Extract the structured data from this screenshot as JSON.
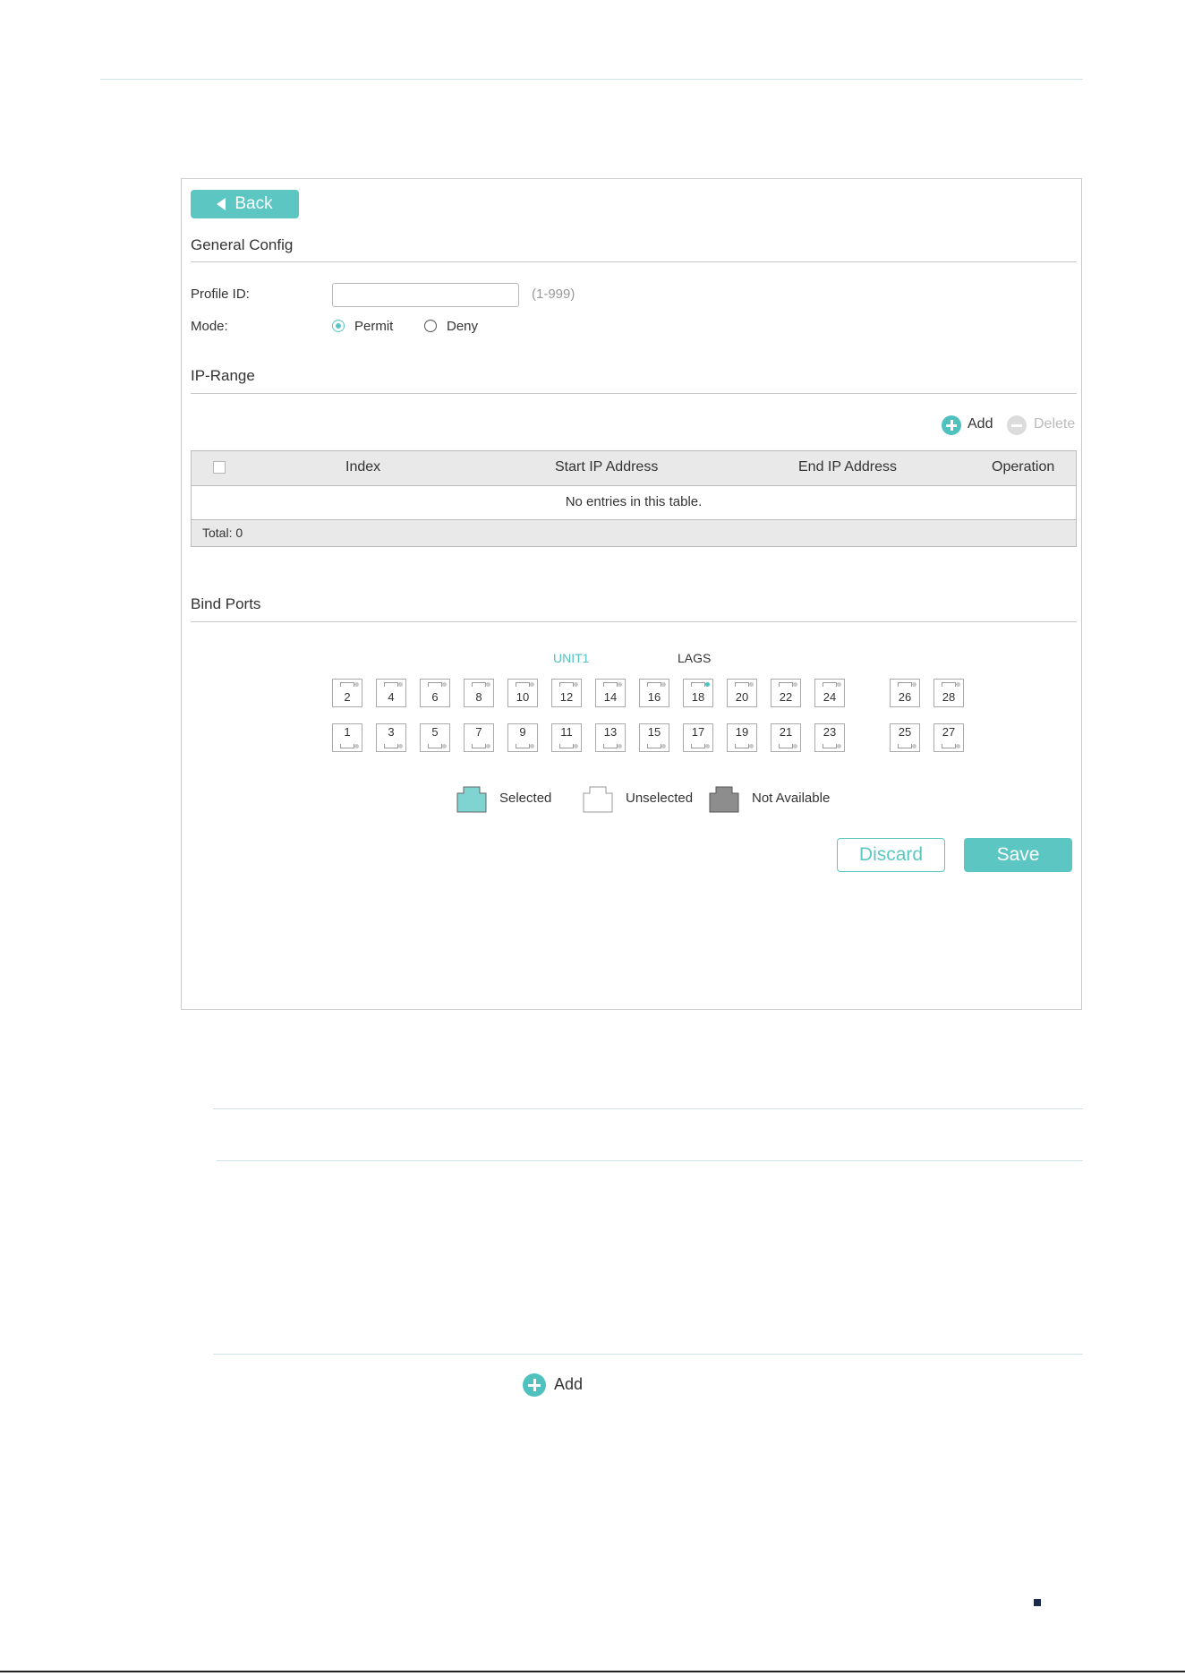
{
  "back_label": "Back",
  "general_config": {
    "title": "General Config",
    "profile_id_label": "Profile ID:",
    "profile_id_value": "",
    "profile_id_hint": "(1-999)",
    "mode_label": "Mode:",
    "mode_options": [
      "Permit",
      "Deny"
    ],
    "mode_selected": "Permit"
  },
  "ip_range": {
    "title": "IP-Range",
    "add_label": "Add",
    "delete_label": "Delete",
    "columns": [
      "Index",
      "Start IP Address",
      "End IP Address",
      "Operation"
    ],
    "empty_message": "No entries in this table.",
    "total": "Total: 0"
  },
  "bind_ports": {
    "title": "Bind Ports",
    "unit_tab": "UNIT1",
    "lags_tab": "LAGS",
    "top_row": [
      "2",
      "4",
      "6",
      "8",
      "10",
      "12",
      "14",
      "16",
      "18",
      "20",
      "22",
      "24",
      "26",
      "28"
    ],
    "bottom_row": [
      "1",
      "3",
      "5",
      "7",
      "9",
      "11",
      "13",
      "15",
      "17",
      "19",
      "21",
      "23",
      "25",
      "27"
    ],
    "legend": [
      "Selected",
      "Unselected",
      "Not Available"
    ]
  },
  "actions": {
    "discard": "Discard",
    "save": "Save"
  },
  "below_panel": {
    "add_label": "Add"
  },
  "colors": {
    "accent": "#5cc6c3",
    "selected": "#7fd3d1",
    "not_available": "#8d8d8d"
  }
}
